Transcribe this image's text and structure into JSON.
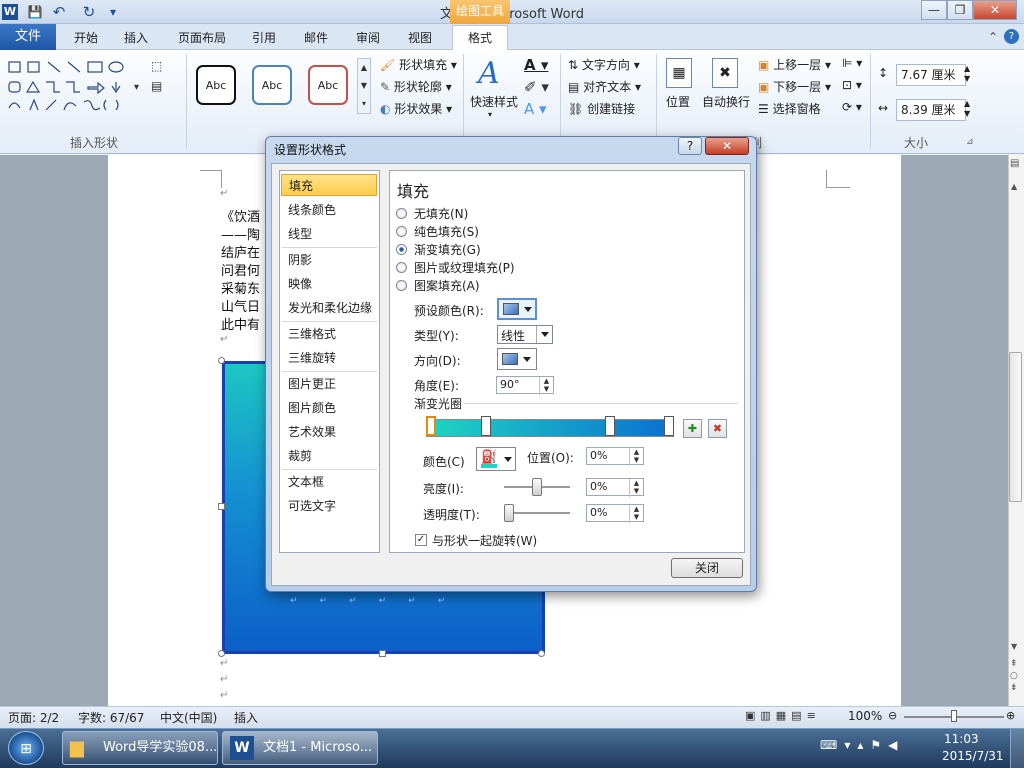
{
  "window": {
    "title": "文档1 - Microsoft Word",
    "contextual_tab_group": "绘图工具",
    "minimize": "—",
    "restore": "❐",
    "close": "✕"
  },
  "qat": {
    "save": "💾",
    "undo": "↶",
    "redo": "↻",
    "customize": "▾",
    "word_icon": "W"
  },
  "tabs": {
    "file": "文件",
    "items": [
      "开始",
      "插入",
      "页面布局",
      "引用",
      "邮件",
      "审阅",
      "视图",
      "格式"
    ]
  },
  "ribbon": {
    "insert_shapes_label": "插入形状",
    "shape_styles": [
      "Abc",
      "Abc",
      "Abc"
    ],
    "shape_fill": "形状填充",
    "shape_outline": "形状轮廓",
    "shape_effects": "形状效果",
    "quick_styles": "快速样式",
    "text_direction": "文字方向",
    "align_text": "对齐文本",
    "create_link": "创建链接",
    "position": "位置",
    "wrap_text": "自动换行",
    "bring_forward": "上移一层",
    "send_backward": "下移一层",
    "selection_pane": "选择窗格",
    "arrange_label": "排列",
    "height": "7.67 厘米",
    "width": "8.39 厘米",
    "size_label": "大小"
  },
  "document": {
    "lines": [
      "《饮酒",
      "——陶",
      "结庐在",
      "问君何",
      "采菊东",
      "山气日",
      "此中有"
    ],
    "return_mark": "↵"
  },
  "statusbar": {
    "page": "页面: 2/2",
    "words": "字数: 67/67",
    "language": "中文(中国)",
    "mode": "插入",
    "zoom": "100%"
  },
  "taskbar": {
    "item1": "Word导学实验08...",
    "item2": "文档1 - Microso...",
    "time": "11:03",
    "date": "2015/7/31"
  },
  "dialog": {
    "title": "设置形状格式",
    "help": "?",
    "close": "✕",
    "categories": [
      "填充",
      "线条颜色",
      "线型",
      "阴影",
      "映像",
      "发光和柔化边缘",
      "三维格式",
      "三维旋转",
      "图片更正",
      "图片颜色",
      "艺术效果",
      "裁剪",
      "文本框",
      "可选文字"
    ],
    "selected_category": "填充",
    "heading": "填充",
    "fill_options": [
      "无填充(N)",
      "纯色填充(S)",
      "渐变填充(G)",
      "图片或纹理填充(P)",
      "图案填充(A)"
    ],
    "selected_fill": "渐变填充(G)",
    "preset_label": "预设颜色(R):",
    "type_label": "类型(Y):",
    "type_value": "线性",
    "direction_label": "方向(D):",
    "angle_label": "角度(E):",
    "angle_value": "90°",
    "stops_label": "渐变光圈",
    "color_label": "颜色(C)",
    "position_label": "位置(O):",
    "position_value": "0%",
    "brightness_label": "亮度(I):",
    "brightness_value": "0%",
    "transparency_label": "透明度(T):",
    "transparency_value": "0%",
    "rotate_label": "与形状一起旋转(W)",
    "close_button": "关闭",
    "gradient_colors": [
      "#1ed5c3",
      "#0b6fd0"
    ],
    "stop_positions": [
      0,
      0.23,
      0.75,
      1
    ]
  },
  "colors": {
    "file_tab": "#2a65b4",
    "selected_category": "#ffd35f",
    "shape_fill_top": "#1cc6c2",
    "shape_fill_bottom": "#0c5fc8",
    "style_outlines": [
      "#111111",
      "#4f81bd",
      "#c0504d"
    ]
  }
}
